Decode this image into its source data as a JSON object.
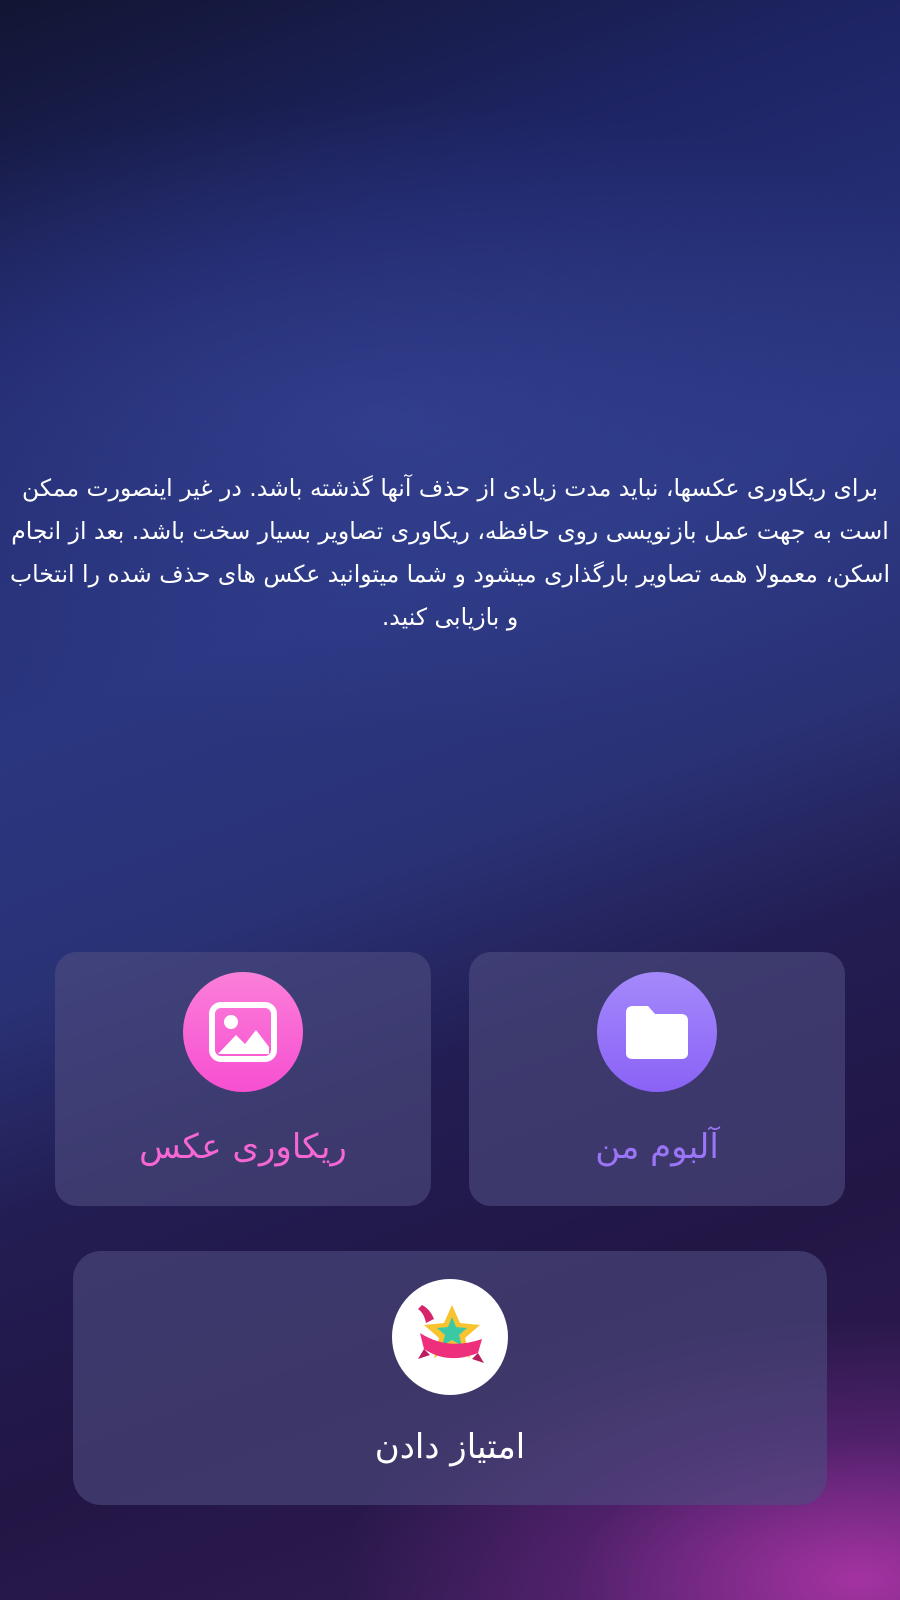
{
  "description": "برای ریکاوری عکسها، نباید مدت زیادی از حذف آنها گذشته باشد. در غیر اینصورت ممکن است به جهت عمل بازنویسی روی حافظه، ریکاوری تصاویر بسیار سخت باشد. بعد از انجام اسکن، معمولا همه تصاویر بارگذاری میشود و شما میتوانید عکس های حذف شده را انتخاب و بازیابی کنید.",
  "cards": {
    "album": {
      "label": "آلبوم من",
      "icon": "folder-icon",
      "color": "#9b75f7"
    },
    "recovery": {
      "label": "ریکاوری عکس",
      "icon": "image-icon",
      "color": "#f767d4"
    },
    "rate": {
      "label": "امتیاز دادن",
      "icon": "star-ribbon-icon",
      "color": "#ffffff"
    }
  }
}
